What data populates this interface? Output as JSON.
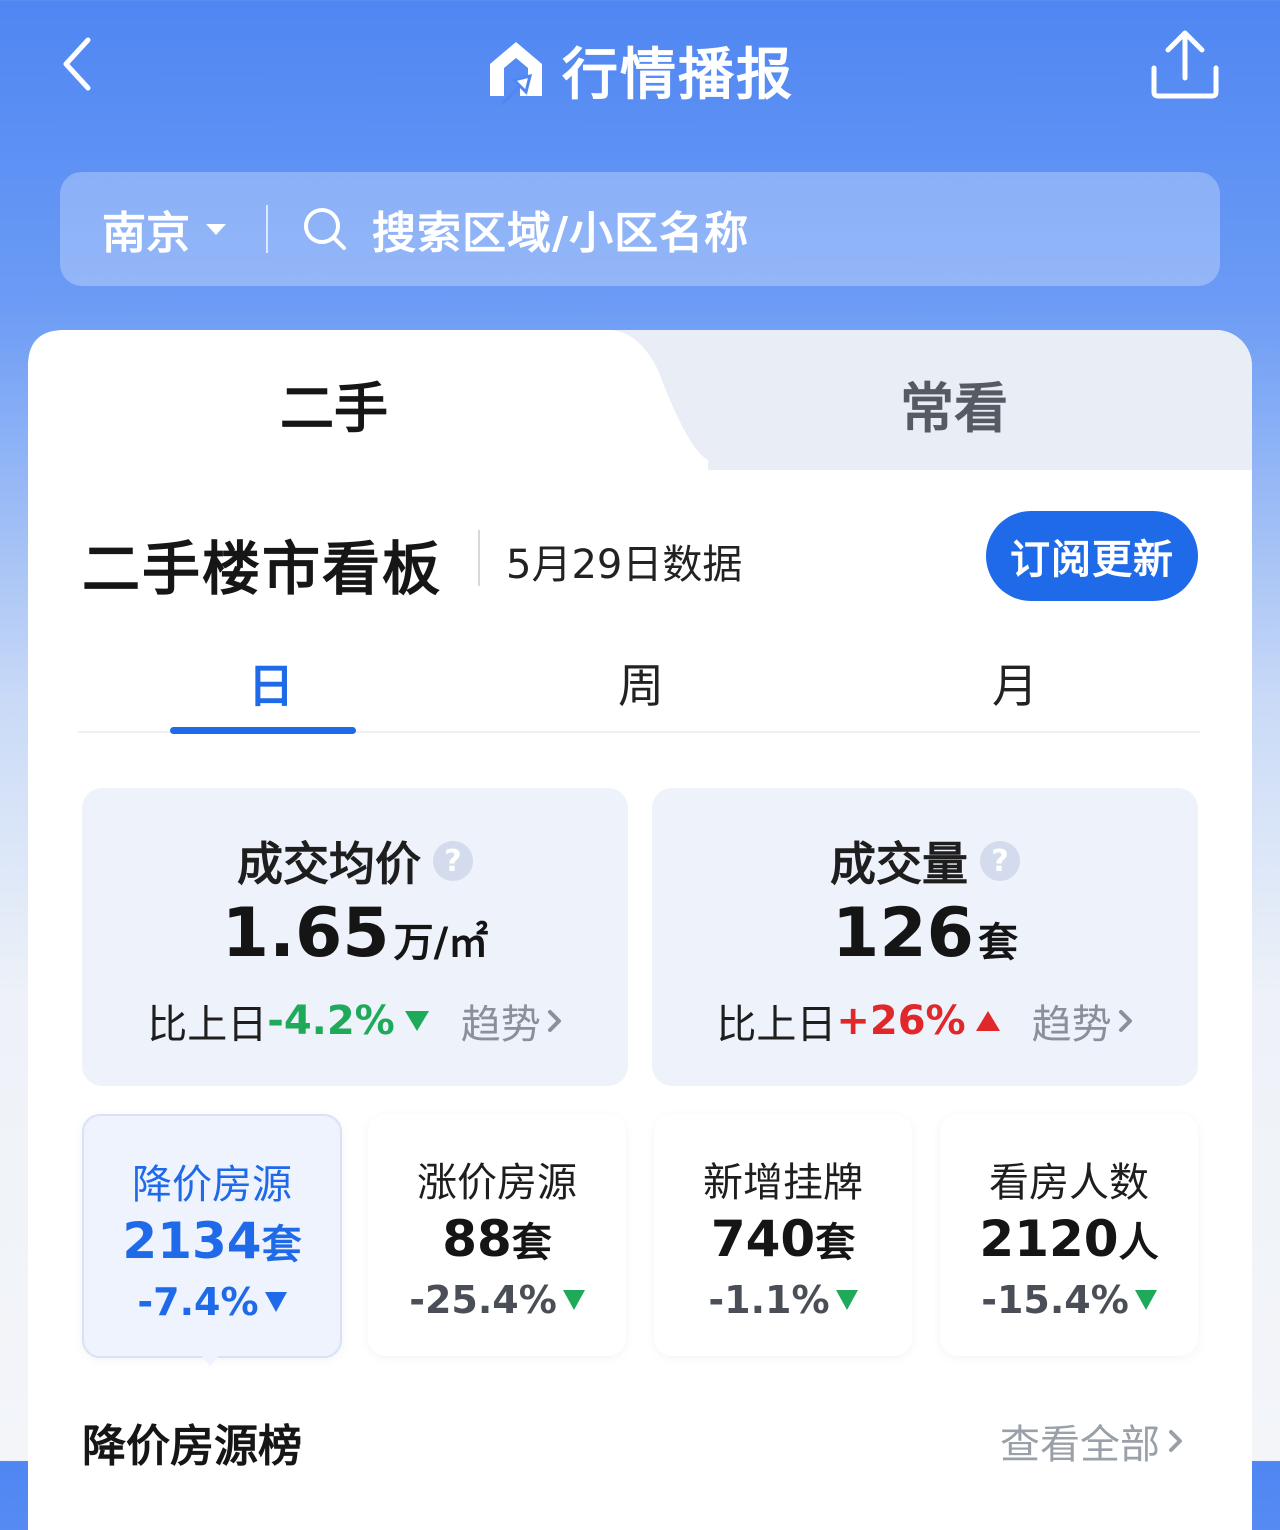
{
  "header": {
    "title": "行情播报"
  },
  "search": {
    "city": "南京",
    "placeholder": "搜索区域/小区名称"
  },
  "tabs": [
    {
      "label": "二手",
      "active": true
    },
    {
      "label": "常看",
      "active": false
    }
  ],
  "board": {
    "title": "二手楼市看板",
    "date": "5月29日数据",
    "subscribe_label": "订阅更新",
    "periods": [
      {
        "label": "日",
        "active": true
      },
      {
        "label": "周",
        "active": false
      },
      {
        "label": "月",
        "active": false
      }
    ]
  },
  "stats": {
    "avg_price": {
      "label": "成交均价",
      "value": "1.65",
      "unit": "万/㎡",
      "compare_prefix": "比上日",
      "change": "-4.2%",
      "direction": "down",
      "trend_label": "趋势"
    },
    "volume": {
      "label": "成交量",
      "value": "126",
      "unit": "套",
      "compare_prefix": "比上日",
      "change": "+26%",
      "direction": "up",
      "trend_label": "趋势"
    }
  },
  "small_stats": [
    {
      "label": "降价房源",
      "value": "2134",
      "unit": "套",
      "change": "-7.4%",
      "selected": true
    },
    {
      "label": "涨价房源",
      "value": "88",
      "unit": "套",
      "change": "-25.4%",
      "selected": false
    },
    {
      "label": "新增挂牌",
      "value": "740",
      "unit": "套",
      "change": "-1.1%",
      "selected": false
    },
    {
      "label": "看房人数",
      "value": "2120",
      "unit": "人",
      "change": "-15.4%",
      "selected": false
    }
  ],
  "list": {
    "title": "降价房源榜",
    "view_all_label": "查看全部"
  },
  "colors": {
    "primary": "#1f6ae8",
    "down": "#1faa5a",
    "up": "#e0282b",
    "header_bg": "#4f86f2"
  }
}
